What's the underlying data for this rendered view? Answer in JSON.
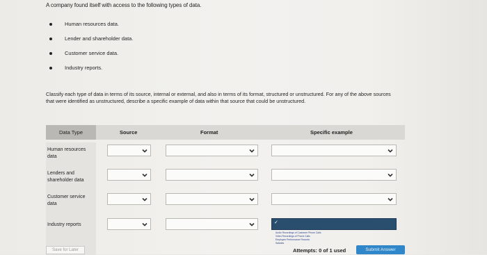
{
  "intro": "A company found itself with access to the following types of data.",
  "bullets": [
    {
      "text": "Human resources data."
    },
    {
      "text": "Lender and shareholder data."
    },
    {
      "text": "Customer service data."
    },
    {
      "text": "Industry reports."
    }
  ],
  "question": "Classify each type of data in terms of its source, internal or external, and also in terms of its format, structured or unstructured. For any of the above sources that were identified as unstructured, describe a specific example of data within that source that could be unstructured.",
  "table": {
    "headers": {
      "data_type": "Data Type",
      "source": "Source",
      "format": "Format",
      "example": "Specific example"
    },
    "rows": [
      {
        "label": "Human resources data",
        "source": "",
        "format": "",
        "example": ""
      },
      {
        "label": "Lenders and shareholder data",
        "source": "",
        "format": "",
        "example": ""
      },
      {
        "label": "Customer service data",
        "source": "",
        "format": "",
        "example": ""
      },
      {
        "label": "Industry reports",
        "source": "",
        "format": "",
        "example": ""
      }
    ],
    "open_dropdown_options": [
      "Audio Recordings of Customer Phone Calls",
      "Video Recordings of Phone Calls",
      "Employee Performance Records",
      "Salaries"
    ]
  },
  "footer": {
    "save_label": "Save for Later",
    "attempts": "Attempts: 0 of 1 used",
    "submit_label": "Submit Answer"
  },
  "icons": {
    "chevron": "chevron-down-icon",
    "check": "check-icon"
  },
  "colors": {
    "selected_dropdown": "#2a4f6e",
    "submit_button": "#2f86c8"
  }
}
